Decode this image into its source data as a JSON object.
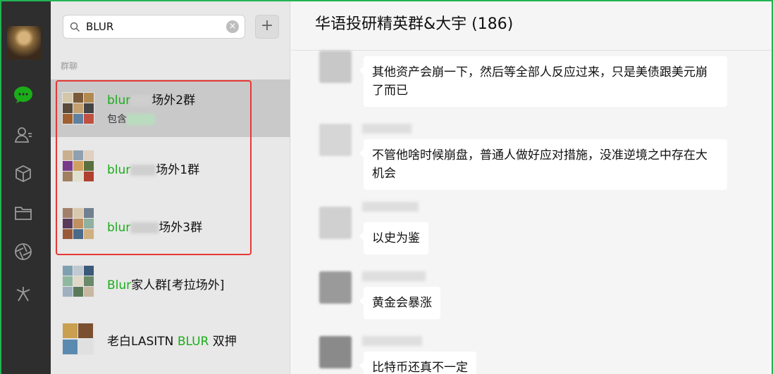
{
  "search": {
    "value": "BLUR"
  },
  "list": {
    "section_label": "群聊",
    "items": [
      {
        "name_hl": "blur",
        "name_rest": "场外2群",
        "sub": "包含"
      },
      {
        "name_hl": "blur",
        "name_rest": "场外1群"
      },
      {
        "name_hl": "blur",
        "name_rest": "场外3群"
      },
      {
        "name_hl": "Blur",
        "name_rest": "家人群[考拉场外]"
      },
      {
        "name_pre": "老白LASITN ",
        "name_hl": "BLUR",
        "name_post": " 双押"
      }
    ]
  },
  "chat": {
    "title": "华语投研精英群&大宇 (186)",
    "messages": [
      {
        "text": "其他资产会崩一下，然后等全部人反应过来，只是美债跟美元崩了而已"
      },
      {
        "text": "不管他啥时候崩盘，普通人做好应对措施，没准逆境之中存在大机会"
      },
      {
        "text": "以史为鉴"
      },
      {
        "text": "黄金会暴涨"
      },
      {
        "text": "比特币还真不一定"
      }
    ]
  },
  "colors": {
    "accent_green": "#1aad19",
    "frame_green": "#22b454",
    "highlight_box": "#e53935"
  }
}
